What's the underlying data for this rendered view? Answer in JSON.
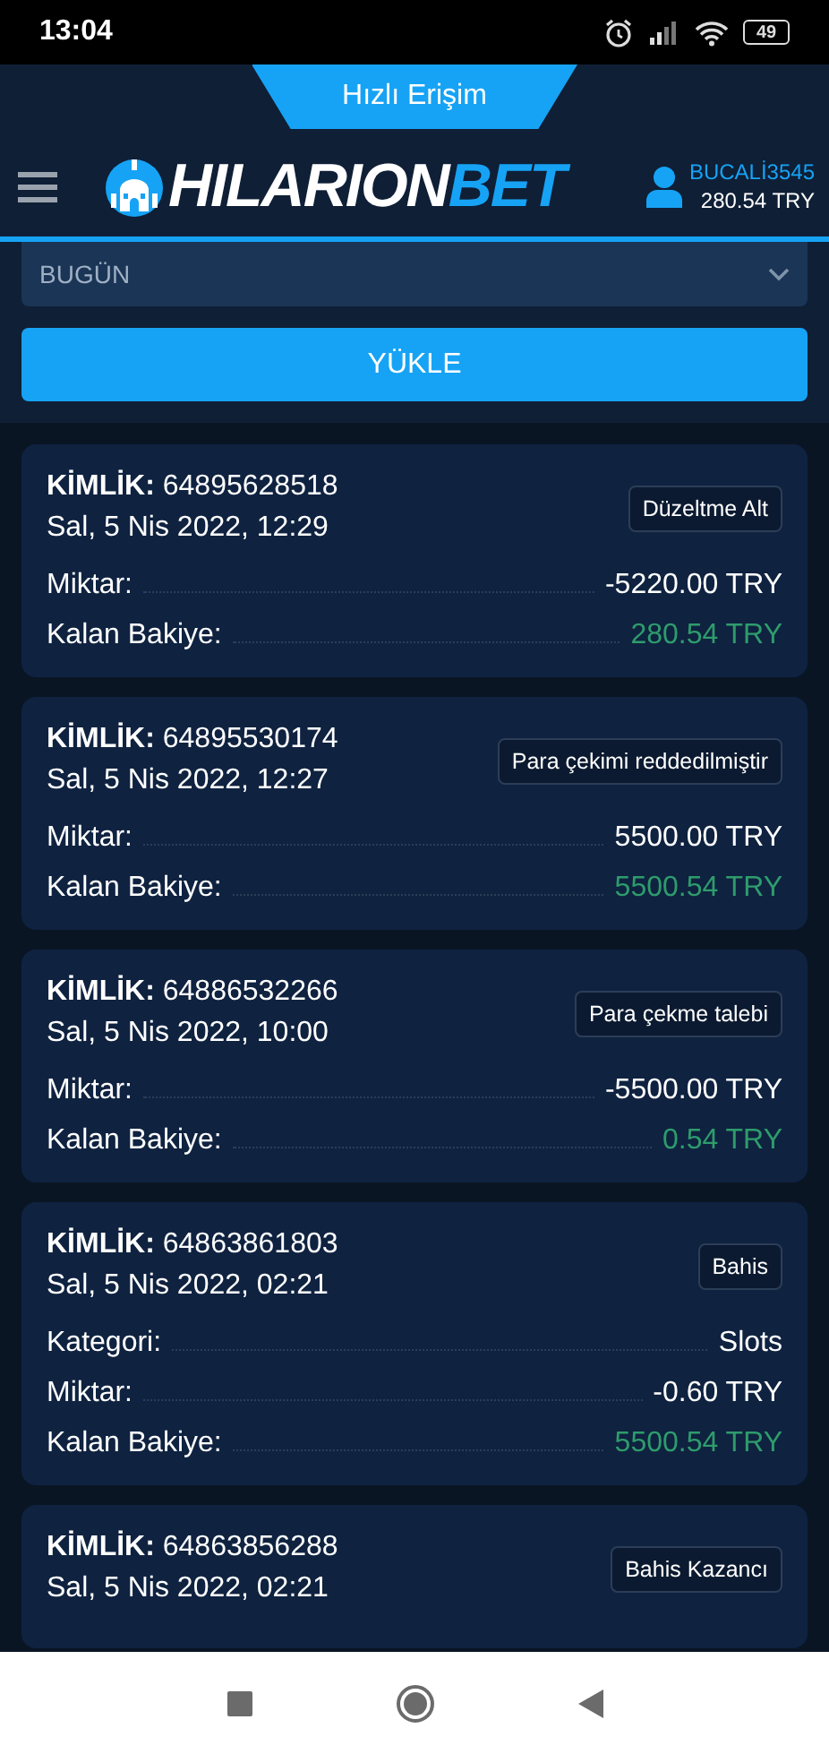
{
  "status_bar": {
    "time": "13:04",
    "battery": "49"
  },
  "quick_access": {
    "label": "Hızlı Erişim"
  },
  "logo": {
    "part_1": "HILARION",
    "part_2": "BET"
  },
  "user": {
    "name": "BUCALİ3545",
    "balance": "280.54 TRY"
  },
  "period_select": {
    "value": "BUGÜN"
  },
  "load_button": {
    "label": "YÜKLE"
  },
  "transactions": [
    {
      "id_label": "KİMLİK:",
      "id": "64895628518",
      "date": "Sal, 5 Nis 2022, 12:29",
      "type": "Düzeltme Alt",
      "rows": [
        {
          "label": "Miktar:",
          "value": "-5220.00 TRY",
          "kind": "plain"
        },
        {
          "label": "Kalan Bakiye:",
          "value": "280.54 TRY",
          "kind": "balance"
        }
      ]
    },
    {
      "id_label": "KİMLİK:",
      "id": "64895530174",
      "date": "Sal, 5 Nis 2022, 12:27",
      "type": "Para çekimi reddedilmiştir",
      "rows": [
        {
          "label": "Miktar:",
          "value": "5500.00 TRY",
          "kind": "plain"
        },
        {
          "label": "Kalan Bakiye:",
          "value": "5500.54 TRY",
          "kind": "balance"
        }
      ]
    },
    {
      "id_label": "KİMLİK:",
      "id": "64886532266",
      "date": "Sal, 5 Nis 2022, 10:00",
      "type": "Para çekme talebi",
      "rows": [
        {
          "label": "Miktar:",
          "value": "-5500.00 TRY",
          "kind": "plain"
        },
        {
          "label": "Kalan Bakiye:",
          "value": "0.54 TRY",
          "kind": "balance"
        }
      ]
    },
    {
      "id_label": "KİMLİK:",
      "id": "64863861803",
      "date": "Sal, 5 Nis 2022, 02:21",
      "type": "Bahis",
      "rows": [
        {
          "label": "Kategori:",
          "value": "Slots",
          "kind": "plain"
        },
        {
          "label": "Miktar:",
          "value": "-0.60 TRY",
          "kind": "plain"
        },
        {
          "label": "Kalan Bakiye:",
          "value": "5500.54 TRY",
          "kind": "balance"
        }
      ]
    },
    {
      "id_label": "KİMLİK:",
      "id": "64863856288",
      "date": "Sal, 5 Nis 2022, 02:21",
      "type": "Bahis Kazancı"
    }
  ]
}
